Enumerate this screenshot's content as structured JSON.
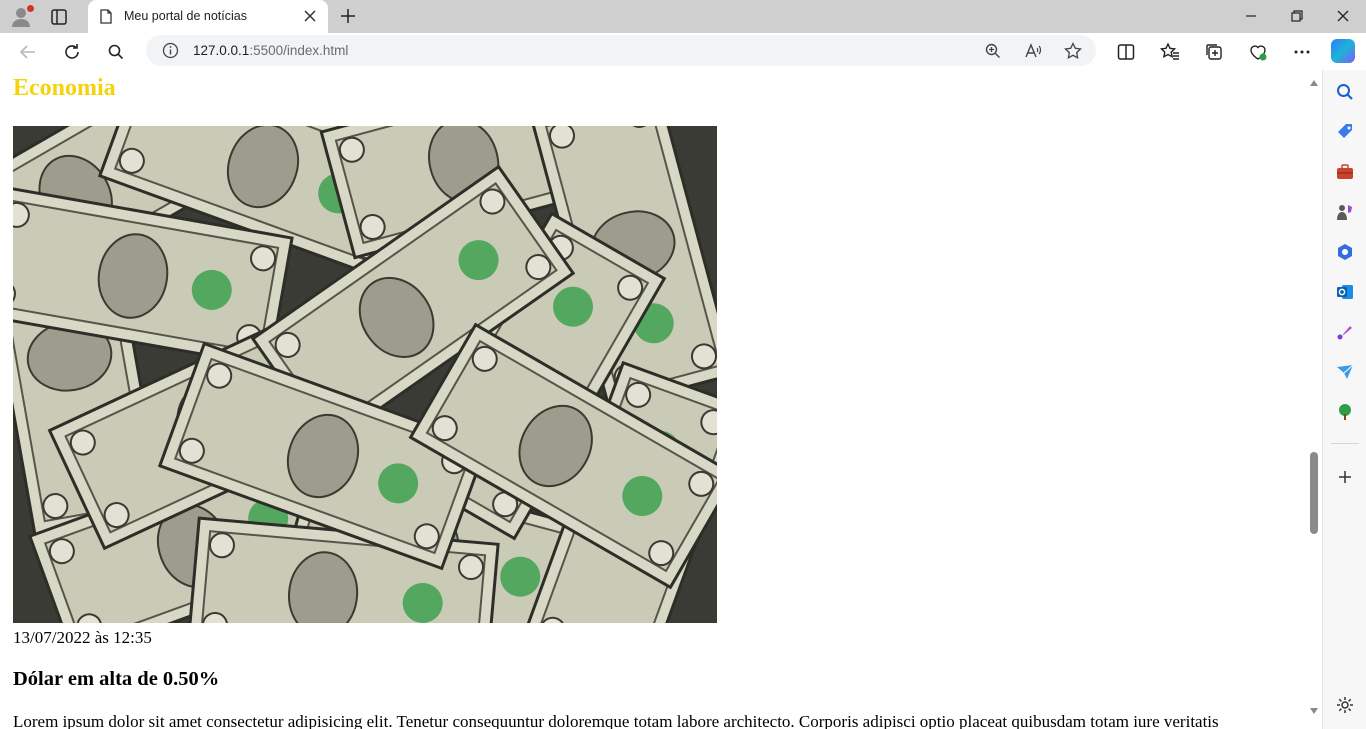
{
  "browser": {
    "tab_title": "Meu portal de notícias",
    "url_host": "127.0.0.1",
    "url_rest": ":5500/index.html"
  },
  "section": {
    "title": "Economia"
  },
  "article": {
    "image_subject": "dollar-bills-photo",
    "date": "13/07/2022 às 12:35",
    "headline": "Dólar em alta de 0.50%",
    "body": "Lorem ipsum dolor sit amet consectetur adipisicing elit. Tenetur consequuntur doloremque totam labore architecto. Corporis adipisci optio placeat quibusdam totam iure veritatis"
  },
  "colors": {
    "section_title": "#f5d20b",
    "titlebar": "#cfcfcf",
    "address_bar": "#f1f3f4"
  }
}
